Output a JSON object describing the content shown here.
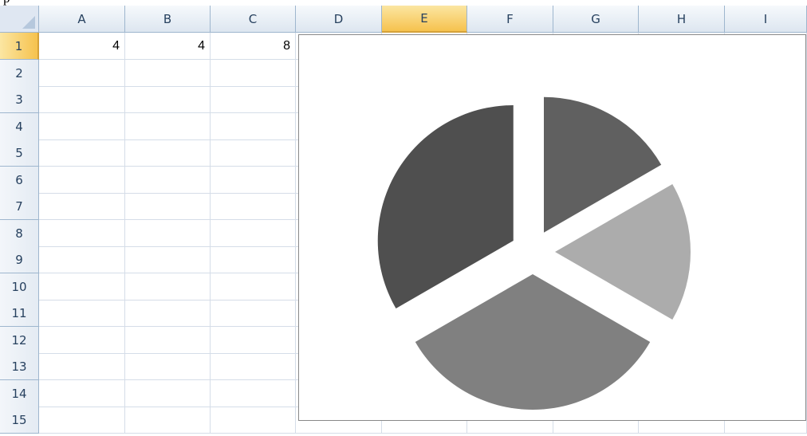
{
  "spreadsheet": {
    "columns": [
      "A",
      "B",
      "C",
      "D",
      "E",
      "F",
      "G",
      "H",
      "I"
    ],
    "selected_column": "E",
    "rows": [
      "1",
      "2",
      "3",
      "4",
      "5",
      "6",
      "7",
      "8",
      "9",
      "10",
      "11",
      "12",
      "13",
      "14",
      "15"
    ],
    "selected_row": "1",
    "row1_values": [
      "4",
      "4",
      "8"
    ]
  },
  "chart_data": {
    "type": "pie",
    "values": [
      4,
      4,
      8,
      8
    ],
    "exploded": true,
    "colors": [
      "#606060",
      "#acacac",
      "#808080",
      "#4f4f4f"
    ],
    "legend": "none"
  }
}
